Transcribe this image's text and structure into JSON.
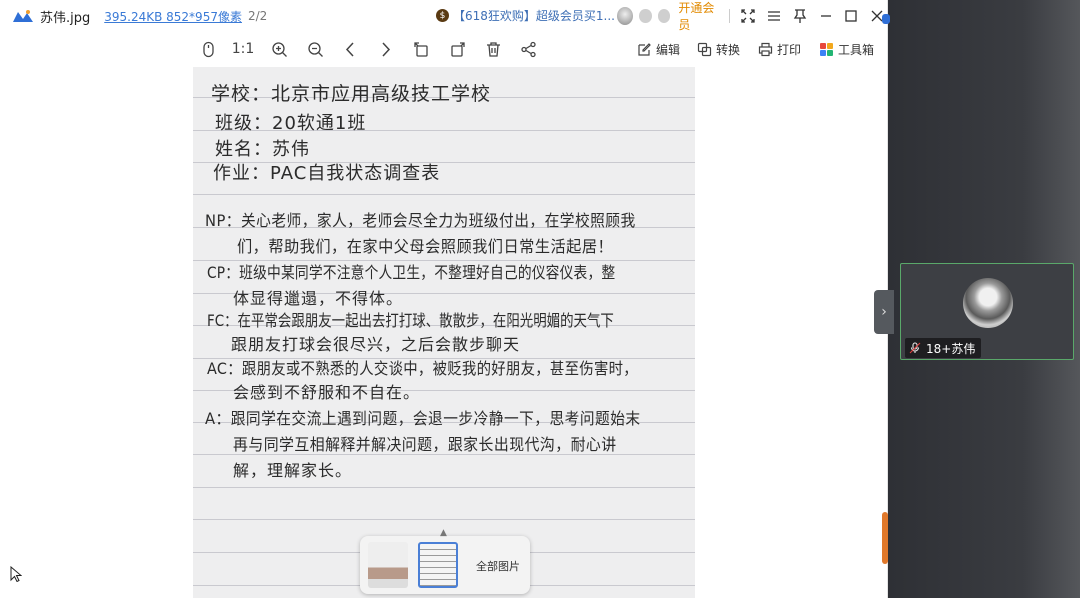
{
  "window": {
    "file_name": "苏伟.jpg",
    "file_meta": "395.24KB 852*957像素",
    "page_index": "2/2",
    "promo_text": "【618狂欢购】超级会员买1...",
    "vip_label": "开通会员"
  },
  "toolbar": {
    "ratio_label": "1:1",
    "edit_label": "编辑",
    "convert_label": "转换",
    "print_label": "打印",
    "toolbox_label": "工具箱"
  },
  "document": {
    "lines": [
      "学校：北京市应用高级技工学校",
      "班级：20软通1班",
      "姓名：苏伟",
      "作业：PAC自我状态调查表",
      "NP：关心老师，家人，老师会尽全力为班级付出，在学校照顾我",
      "们，帮助我们，在家中父母会照顾我们日常生活起居！",
      "CP：班级中某同学不注意个人卫生，不整理好自己的仪容仪表，整",
      "体显得邋遢，不得体。",
      "FC：在平常会跟朋友一起出去打打球、散散步，在阳光明媚的天气下",
      "跟朋友打球会很尽兴，之后会散步聊天",
      "AC：跟朋友或不熟悉的人交谈中，被贬我的好朋友，甚至伤害时，",
      "会感到不舒服和不自在。",
      "A：跟同学在交流上遇到问题，会退一步冷静一下，思考问题始末",
      "再与同学互相解释并解决问题，跟家长出现代沟，耐心讲",
      "解，理解家长。"
    ]
  },
  "thumbnails": {
    "all_label": "全部图片"
  },
  "participant": {
    "name": "18+苏伟"
  }
}
